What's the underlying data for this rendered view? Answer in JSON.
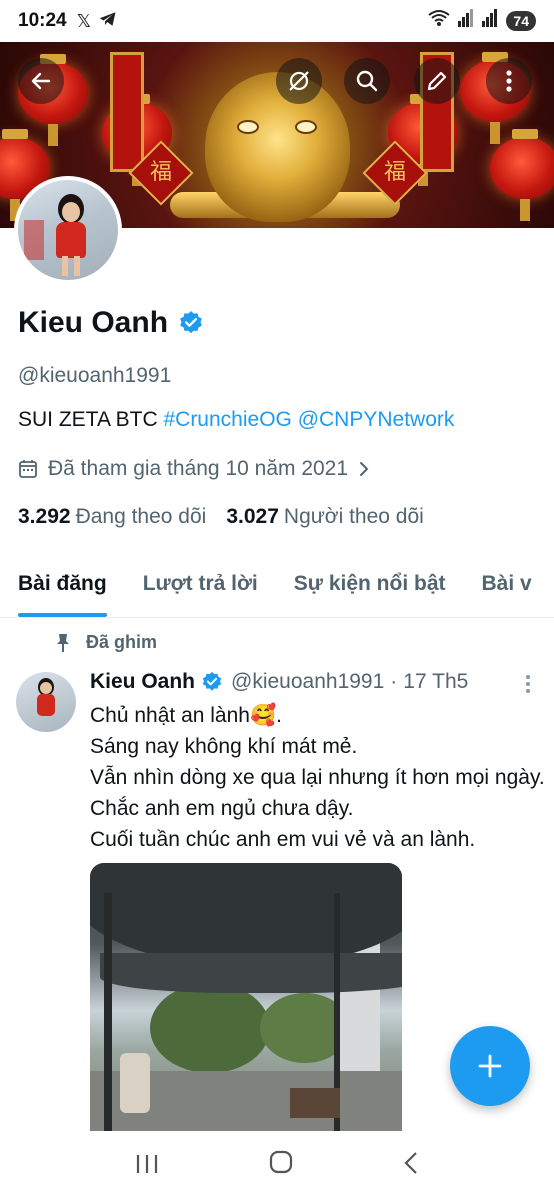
{
  "status_bar": {
    "time": "10:24",
    "battery": "74"
  },
  "profile": {
    "name": "Kieu Oanh",
    "handle": "@kieuoanh1991",
    "bio_plain": "SUI ZETA BTC ",
    "bio_link1": "#CrunchieOG",
    "bio_link2": "@CNPYNetwork",
    "joined": "Đã tham gia tháng 10 năm 2021",
    "following_count": "3.292",
    "following_label": "Đang theo dõi",
    "followers_count": "3.027",
    "followers_label": "Người theo dõi"
  },
  "tabs": [
    {
      "label": "Bài đăng",
      "active": true
    },
    {
      "label": "Lượt trả lời"
    },
    {
      "label": "Sự kiện nổi bật"
    },
    {
      "label": "Bài v"
    }
  ],
  "pinned_post": {
    "pinned_label": "Đã ghim",
    "author": "Kieu Oanh",
    "handle": "@kieuoanh1991",
    "separator": "·",
    "date": "17 Th5",
    "lines": [
      "Chủ nhật an lành🥰.",
      "Sáng nay không khí mát mẻ.",
      "Vẫn nhìn dòng xe qua lại nhưng ít hơn mọi ngày. Chắc anh em ngủ chưa dậy.",
      "Cuối tuần chúc anh em vui vẻ và an lành."
    ]
  },
  "banner": {
    "fu_char": "福"
  },
  "colors": {
    "accent": "#1d9bf0",
    "text": "#0f1419",
    "muted": "#536471"
  }
}
